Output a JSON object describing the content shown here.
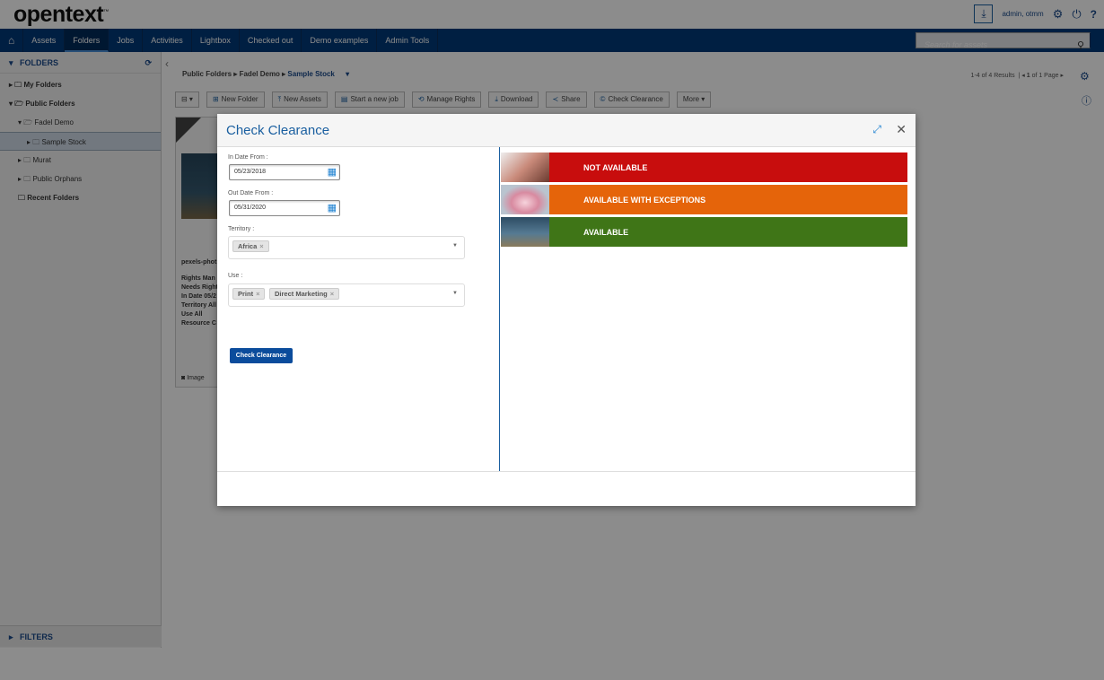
{
  "header": {
    "logo": "opentext",
    "tm": "™",
    "user": "admin, otmm",
    "download_icon": "download-icon"
  },
  "nav": {
    "tabs": [
      "Assets",
      "Folders",
      "Jobs",
      "Activities",
      "Lightbox",
      "Checked out",
      "Demo examples",
      "Admin Tools"
    ],
    "active": "Folders",
    "search_placeholder": "Search for assets"
  },
  "sidebar": {
    "header": "FOLDERS",
    "items": [
      "My Folders",
      "Public Folders",
      "Fadel Demo",
      "Sample Stock",
      "Murat",
      "Public Orphans",
      "Recent Folders"
    ],
    "selected": "Sample Stock",
    "filters": "FILTERS"
  },
  "breadcrumb": [
    "Public Folders",
    "Fadel Demo",
    "Sample Stock"
  ],
  "toolbar": [
    "New Folder",
    "New Assets",
    "Start a new job",
    "Manage Rights",
    "Download",
    "Share",
    "Check Clearance",
    "More ▾"
  ],
  "pagination": {
    "results": "1-4 of 4 Results",
    "page": "1",
    "of_pages": "of 1 Page"
  },
  "card": {
    "name": "pexels-phot",
    "lines": [
      "Rights Man",
      "Needs Right",
      "In Date 05/2",
      "Territory All",
      "Use All",
      "Resource C"
    ],
    "type": "Image"
  },
  "modal": {
    "title": "Check Clearance",
    "in_date_label": "In Date From :",
    "in_date": "05/23/2018",
    "out_date_label": "Out Date From :",
    "out_date": "05/31/2020",
    "territory_label": "Territory :",
    "territory": [
      "Africa"
    ],
    "use_label": "Use :",
    "use": [
      "Print",
      "Direct Marketing"
    ],
    "button": "Check Clearance",
    "results": [
      {
        "status": "NOT AVAILABLE",
        "color": "#c80d0d"
      },
      {
        "status": "AVAILABLE WITH EXCEPTIONS",
        "color": "#e5640a"
      },
      {
        "status": "AVAILABLE",
        "color": "#3f7517"
      }
    ]
  }
}
